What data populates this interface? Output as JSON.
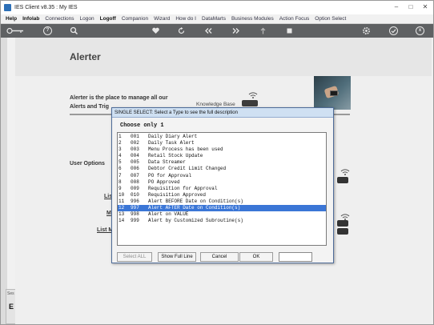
{
  "window": {
    "title": "IES Client v8.35 : My IES",
    "controls": [
      "–",
      "□",
      "✕"
    ]
  },
  "menu": {
    "items": [
      {
        "label": "Help",
        "bold": true
      },
      {
        "label": "Infolab",
        "bold": true
      },
      {
        "label": "Connections",
        "bold": false
      },
      {
        "label": "Logon",
        "bold": false
      },
      {
        "label": "Logoff",
        "bold": true
      },
      {
        "label": "Companion",
        "bold": false
      },
      {
        "label": "Wizard",
        "bold": false
      },
      {
        "label": "How do I",
        "bold": false
      },
      {
        "label": "DataMarts",
        "bold": false
      },
      {
        "label": "Business Modules",
        "bold": false
      },
      {
        "label": "Action Focus",
        "bold": false
      },
      {
        "label": "Option Select",
        "bold": false
      }
    ]
  },
  "toolbar": {
    "icons": [
      "key-icon",
      "help-icon",
      "search-icon",
      "heart-icon",
      "refresh-icon",
      "rewind-icon",
      "fast-forward-icon",
      "upload-icon",
      "stop-icon",
      "settings-icon",
      "check-icon",
      "close-icon"
    ],
    "help_glyph": "?",
    "close_glyph": "x"
  },
  "sidebar": {
    "label": "Ses",
    "letter": "E"
  },
  "page": {
    "title": "Alerter",
    "intro_line1": "Alerter is the place to manage all our",
    "intro_line2": "Alerts and Trig",
    "knowledge_label": "Knowledge Base",
    "user_options": "User Options",
    "links": [
      "Lis",
      "M",
      "List M"
    ]
  },
  "dialog": {
    "title": "SINGLE SELECT: Select a Type to see the full description",
    "caption": "Choose only 1",
    "selected_index": 11,
    "rows": [
      {
        "idx": "1",
        "code": "001",
        "desc": "Daily Diary Alert"
      },
      {
        "idx": "2",
        "code": "002",
        "desc": "Daily Task Alert"
      },
      {
        "idx": "3",
        "code": "003",
        "desc": "Menu Process has been used"
      },
      {
        "idx": "4",
        "code": "004",
        "desc": "Retail Stock Update"
      },
      {
        "idx": "5",
        "code": "005",
        "desc": "Data Streamer"
      },
      {
        "idx": "6",
        "code": "006",
        "desc": "Debtor Credit Limit Changed"
      },
      {
        "idx": "7",
        "code": "007",
        "desc": "PO for Approval"
      },
      {
        "idx": "8",
        "code": "008",
        "desc": "PO Approved"
      },
      {
        "idx": "9",
        "code": "009",
        "desc": "Requisition for Approval"
      },
      {
        "idx": "10",
        "code": "010",
        "desc": "Requisition Approved"
      },
      {
        "idx": "11",
        "code": "996",
        "desc": "Alert BEFORE Date on Condition(s)"
      },
      {
        "idx": "12",
        "code": "997",
        "desc": "Alert AFTER Date on Condition(s)"
      },
      {
        "idx": "13",
        "code": "998",
        "desc": "Alert on VALUE"
      },
      {
        "idx": "14",
        "code": "999",
        "desc": "Alert by Customized Subroutine(s)"
      }
    ],
    "buttons": {
      "select_all": "Select ALL",
      "show_full_line": "Show Full Line",
      "cancel": "Cancel",
      "ok": "OK"
    },
    "colors": {
      "selected_row": "#3b76d6",
      "title_bar": "#cfe0f2"
    }
  }
}
